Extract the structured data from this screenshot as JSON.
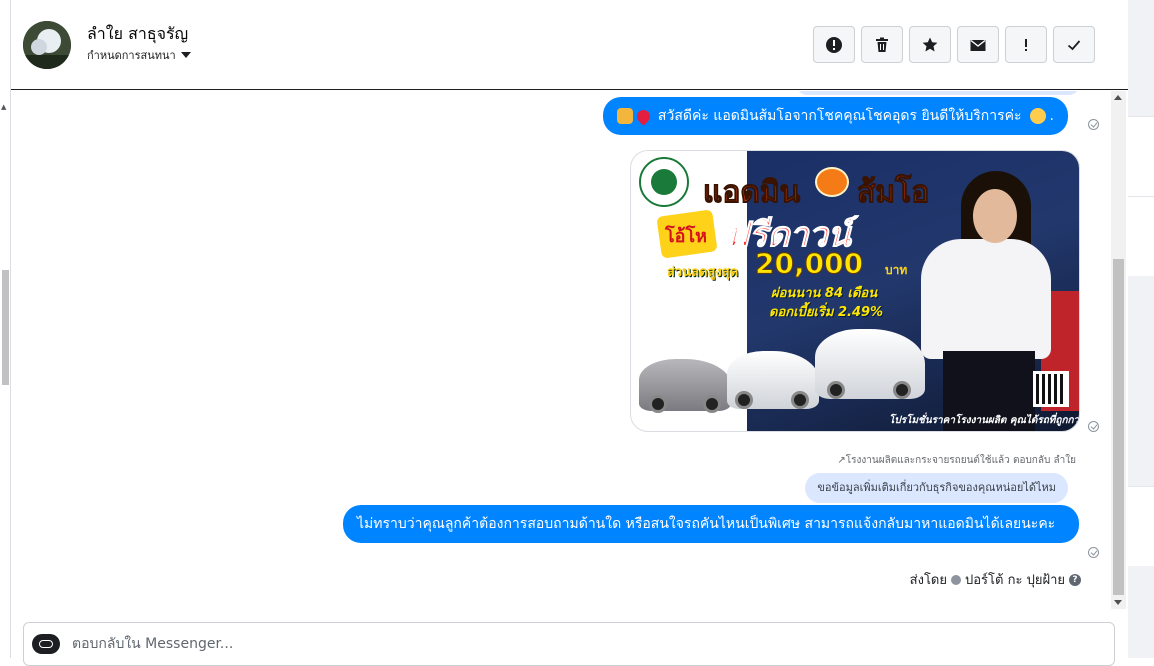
{
  "header": {
    "contact_name": "ลำใย สาธุจรัญ",
    "assign_label": "กำหนดการสนทนา",
    "actions": [
      {
        "name": "report-spam-button",
        "icon": "exclamation-circle-icon"
      },
      {
        "name": "delete-button",
        "icon": "trash-icon"
      },
      {
        "name": "star-button",
        "icon": "star-icon"
      },
      {
        "name": "mark-unread-button",
        "icon": "envelope-icon"
      },
      {
        "name": "flag-important-button",
        "icon": "exclamation-icon"
      },
      {
        "name": "mark-done-button",
        "icon": "check-icon"
      }
    ]
  },
  "messages": {
    "greeting": "สวัสดีค่ะ แอดมินส้มโอจากโชคคุณโชคอุดร ยินดีให้บริการค่ะ",
    "greeting_end": ".",
    "reply_note": "↗โรงงานผลิตและกระจายรถยนต์ใช้แล้ว ตอบกลับ ลำใย",
    "quoted": "ขอข้อมูลเพิ่มเติมเกี่ยวกับธุรกิจของคุณหน่อยได้ไหม",
    "answer": "ไม่ทราบว่าคุณลูกค้าต้องการสอบถามด้านใด หรือสนใจรถคันไหนเป็นพิเศษ สามารถแจ้งกลับมาหาแอดมินได้เลยนะคะ",
    "sent_by_label": "ส่งโดย",
    "sent_by_name": "ปอร์โต้ กะ ปุยฝ้าย"
  },
  "promo": {
    "title_left": "แอดมิน",
    "title_right": "ส้มโอ",
    "burst": "โอ้โห",
    "headline": "ฟรีดาวน์",
    "discount_label": "ส่วนลดสูงสุด",
    "discount_amount": "20,000",
    "currency": "บาท",
    "installment": "ผ่อนนาน 84 เดือน",
    "interest": "ดอกเบี้ยเริ่ม 2.49%",
    "footer": "โปรโมชั่นราคาโรงงานผลิต คุณได้รถที่ถูกกว่า"
  },
  "composer": {
    "placeholder": "ตอบกลับใน Messenger..."
  },
  "colors": {
    "accent": "#0084ff",
    "quoted_bg": "#dbe7ff"
  }
}
